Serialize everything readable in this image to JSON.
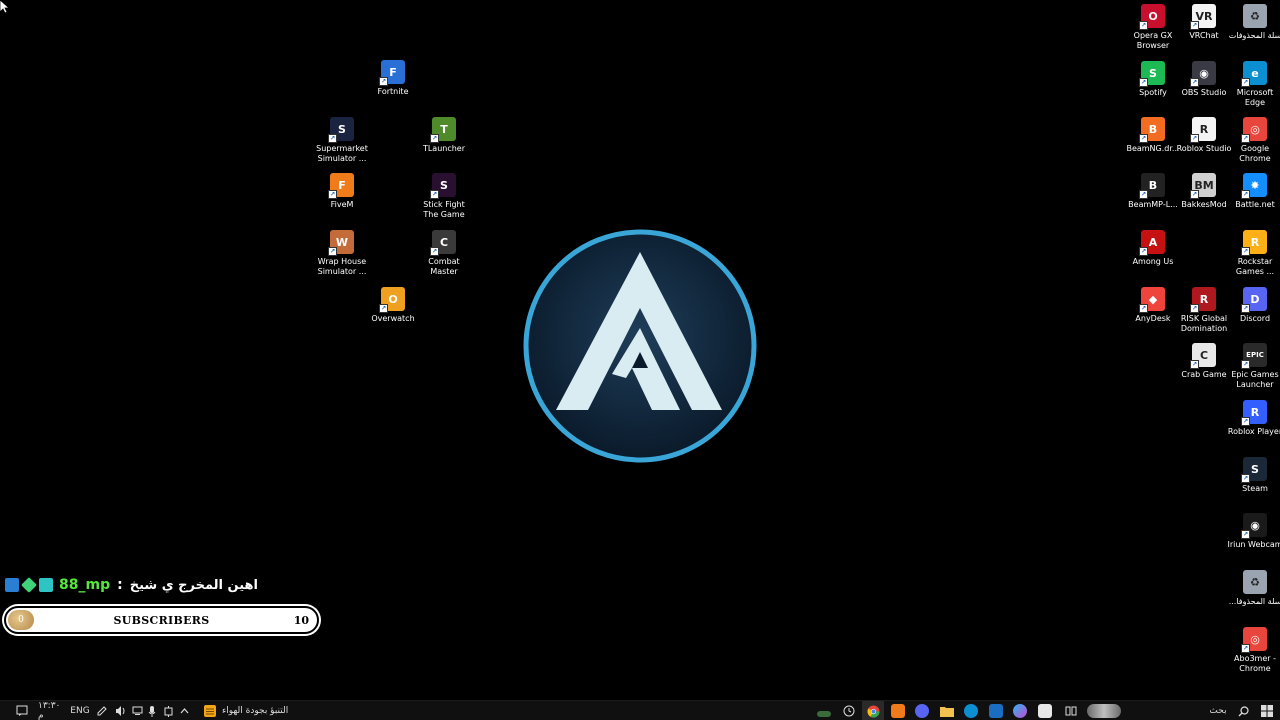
{
  "desktop": {
    "left_icons": [
      {
        "id": "fortnite",
        "label": "Fortnite",
        "color": "#2a6fd6",
        "glyph": "F"
      },
      {
        "id": "supermarket",
        "label": "Supermarket Simulator ...",
        "color": "#1a2440",
        "glyph": "S"
      },
      {
        "id": "tlauncher",
        "label": "TLauncher",
        "color": "#4f8a2b",
        "glyph": "T"
      },
      {
        "id": "fivem",
        "label": "FiveM",
        "color": "#f07b1a",
        "glyph": "F"
      },
      {
        "id": "stickfight",
        "label": "Stick Fight The Game",
        "color": "#2a1030",
        "glyph": "S"
      },
      {
        "id": "wraphouse",
        "label": "Wrap House Simulator ...",
        "color": "#c46b3a",
        "glyph": "W"
      },
      {
        "id": "combatmaster",
        "label": "Combat Master",
        "color": "#3a3a3a",
        "glyph": "C"
      },
      {
        "id": "overwatch",
        "label": "Overwatch",
        "color": "#f0a020",
        "glyph": "O"
      }
    ],
    "right_icons": [
      {
        "id": "operagx",
        "label": "Opera GX Browser",
        "color": "#c8102e",
        "glyph": "O"
      },
      {
        "id": "vrchat",
        "label": "VRChat",
        "color": "#f4f4f4",
        "glyph": "VR"
      },
      {
        "id": "recyclebin",
        "label": "سلة المحذوفات",
        "color": "#9aa4b0",
        "glyph": "♻"
      },
      {
        "id": "spotify",
        "label": "Spotify",
        "color": "#1db954",
        "glyph": "S"
      },
      {
        "id": "obs",
        "label": "OBS Studio",
        "color": "#3a3a44",
        "glyph": "◉"
      },
      {
        "id": "edge",
        "label": "Microsoft Edge",
        "color": "#0c8fd0",
        "glyph": "e"
      },
      {
        "id": "beamng",
        "label": "BeamNG.dr...",
        "color": "#f26d21",
        "glyph": "B"
      },
      {
        "id": "robloxstudio",
        "label": "Roblox Studio",
        "color": "#f4f4f4",
        "glyph": "R"
      },
      {
        "id": "chrome",
        "label": "Google Chrome",
        "color": "#e8453c",
        "glyph": "◎"
      },
      {
        "id": "beammp",
        "label": "BeamMP-L...",
        "color": "#222222",
        "glyph": "B"
      },
      {
        "id": "bakkesmod",
        "label": "BakkesMod",
        "color": "#d0d0d0",
        "glyph": "BM"
      },
      {
        "id": "battlenet",
        "label": "Battle.net",
        "color": "#148eff",
        "glyph": "✸"
      },
      {
        "id": "amongus",
        "label": "Among Us",
        "color": "#c51111",
        "glyph": "A"
      },
      {
        "id": "rockstar",
        "label": "Rockstar Games ...",
        "color": "#fcaf17",
        "glyph": "R"
      },
      {
        "id": "anydesk",
        "label": "AnyDesk",
        "color": "#ef443b",
        "glyph": "◆"
      },
      {
        "id": "risk",
        "label": "RISK Global Domination",
        "color": "#b01820",
        "glyph": "R"
      },
      {
        "id": "discord",
        "label": "Discord",
        "color": "#5865f2",
        "glyph": "D"
      },
      {
        "id": "crabgame",
        "label": "Crab Game",
        "color": "#e8e8e8",
        "glyph": "C"
      },
      {
        "id": "epic",
        "label": "Epic Games Launcher",
        "color": "#2a2a2a",
        "glyph": "EPIC"
      },
      {
        "id": "robloxplayer",
        "label": "Roblox Player",
        "color": "#335fff",
        "glyph": "R"
      },
      {
        "id": "steam",
        "label": "Steam",
        "color": "#1b2838",
        "glyph": "S"
      },
      {
        "id": "iriun",
        "label": "Iriun Webcam",
        "color": "#1a1a1a",
        "glyph": "◉"
      },
      {
        "id": "recyclebin2",
        "label": "سلة المحذوفا...",
        "color": "#9aa4b0",
        "glyph": "♻"
      },
      {
        "id": "abo3mer",
        "label": "Abo3mer - Chrome",
        "color": "#e8453c",
        "glyph": "◎"
      }
    ]
  },
  "overlay": {
    "chat_user": "88_mp",
    "chat_separator": ":",
    "chat_message": "اهين المخرج ي شيخ",
    "badge_colors": [
      "#2a7fd4",
      "#3fd27a",
      "#2fc4c4"
    ],
    "subscribers_label": "SUBSCRIBERS",
    "subscribers_count": "10",
    "subscribers_knob": "0"
  },
  "taskbar": {
    "clock": "١٣:٣٠ م",
    "language": "ENG",
    "weather_text": "التنبؤ بجودة الهواء",
    "search_label": "بحث"
  },
  "colors": {
    "logo_ring": "#3aa6d8",
    "logo_fill": "#0f2236",
    "logo_letter": "#d8ecf2"
  }
}
